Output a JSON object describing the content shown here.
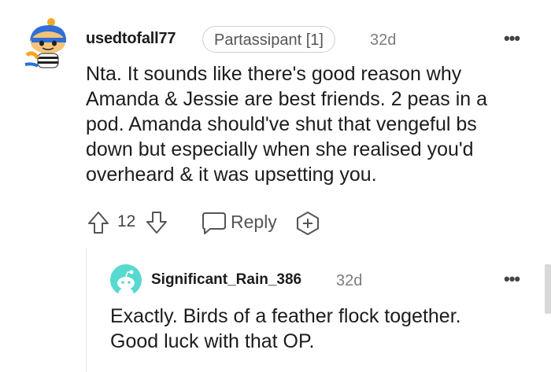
{
  "comment": {
    "author": "usedtofall77",
    "flair": "Partassipant [1]",
    "age": "32d",
    "body_lines": [
      "Nta. It sounds like there's good reason why",
      "Amanda & Jessie are best friends. 2 peas in a",
      "pod. Amanda should've shut that vengeful bs",
      "down but especially when she realised you'd",
      "overheard & it was upsetting you."
    ],
    "score": "12",
    "reply_label": "Reply",
    "more_label": "•••"
  },
  "reply": {
    "author": "Significant_Rain_386",
    "age": "32d",
    "body_lines": [
      "Exactly. Birds of a feather flock together.",
      "Good luck with that OP."
    ],
    "more_label": "•••"
  },
  "colors": {
    "text": "#1c1c1c",
    "muted": "#7c7c7c",
    "reply_avatar": "#57d9d0",
    "avatar_bg_blue": "#2f6fd6",
    "avatar_orange": "#f5a623"
  }
}
